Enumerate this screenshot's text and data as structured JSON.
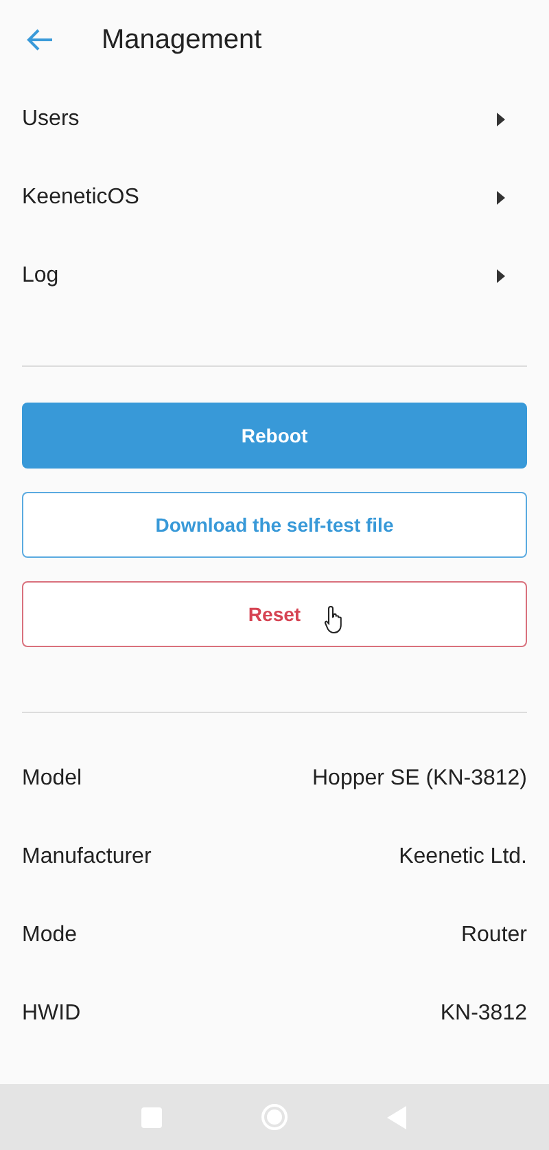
{
  "header": {
    "title": "Management"
  },
  "menu": [
    {
      "label": "Users"
    },
    {
      "label": "KeeneticOS"
    },
    {
      "label": "Log"
    }
  ],
  "actions": [
    {
      "label": "Reboot",
      "kind": "primary"
    },
    {
      "label": "Download the self-test file",
      "kind": "outline"
    },
    {
      "label": "Reset",
      "kind": "danger"
    }
  ],
  "info": [
    {
      "label": "Model",
      "value": "Hopper SE (KN-3812)"
    },
    {
      "label": "Manufacturer",
      "value": "Keenetic Ltd."
    },
    {
      "label": "Mode",
      "value": "Router"
    },
    {
      "label": "HWID",
      "value": "KN-3812"
    }
  ]
}
